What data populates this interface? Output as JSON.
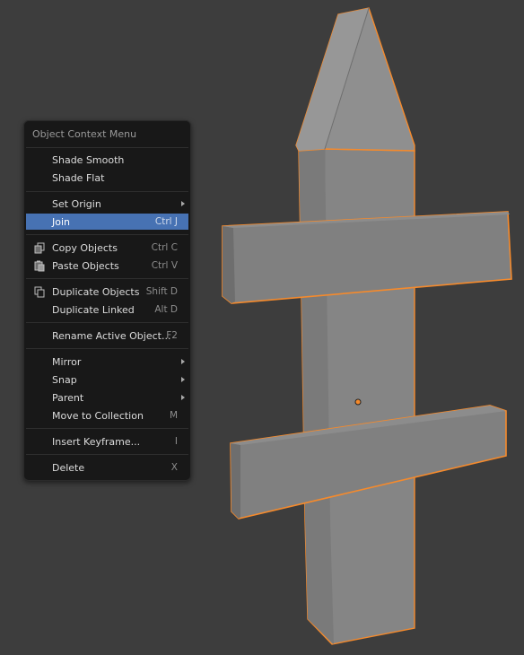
{
  "menu": {
    "title": "Object Context Menu",
    "items": [
      {
        "label": "Shade Smooth",
        "shortcut": ""
      },
      {
        "label": "Shade Flat",
        "shortcut": ""
      },
      {
        "label": "Set Origin",
        "shortcut": ""
      },
      {
        "label": "Join",
        "shortcut": "Ctrl J"
      },
      {
        "label": "Copy Objects",
        "shortcut": "Ctrl C"
      },
      {
        "label": "Paste Objects",
        "shortcut": "Ctrl V"
      },
      {
        "label": "Duplicate Objects",
        "shortcut": "Shift D"
      },
      {
        "label": "Duplicate Linked",
        "shortcut": "Alt D"
      },
      {
        "label": "Rename Active Object...",
        "shortcut": "F2"
      },
      {
        "label": "Mirror",
        "shortcut": ""
      },
      {
        "label": "Snap",
        "shortcut": ""
      },
      {
        "label": "Parent",
        "shortcut": ""
      },
      {
        "label": "Move to Collection",
        "shortcut": "M"
      },
      {
        "label": "Insert Keyframe...",
        "shortcut": "I"
      },
      {
        "label": "Delete",
        "shortcut": "X"
      }
    ]
  },
  "icons": {
    "copy": "copy-icon",
    "paste": "paste-icon",
    "duplicate": "duplicate-icon",
    "submenu": "chevron-right-icon"
  },
  "colors": {
    "viewport_bg": "#3d3d3d",
    "menu_bg": "#181818",
    "highlight": "#4772b3",
    "selection_outline": "#f58a2c",
    "object_fill": "#8a8a8a"
  }
}
